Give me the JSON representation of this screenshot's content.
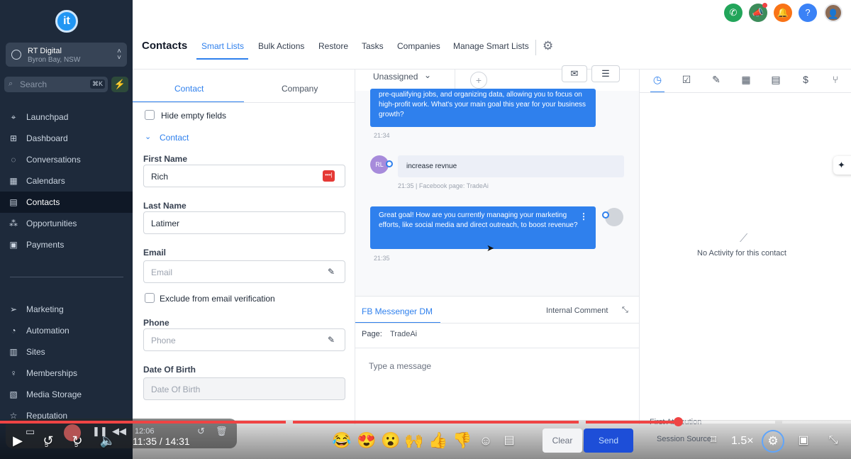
{
  "sidebar": {
    "logo_letter": "it",
    "account_name": "RT Digital",
    "account_location": "Byron Bay, NSW",
    "search_placeholder": "Search",
    "search_shortcut": "⌘K",
    "items_top": [
      {
        "label": "Launchpad",
        "icon": "rocket-icon"
      },
      {
        "label": "Dashboard",
        "icon": "grid-icon"
      },
      {
        "label": "Conversations",
        "icon": "chat-icon"
      },
      {
        "label": "Calendars",
        "icon": "calendar-icon"
      },
      {
        "label": "Contacts",
        "icon": "contact-card-icon",
        "active": true
      },
      {
        "label": "Opportunities",
        "icon": "funnel-icon"
      },
      {
        "label": "Payments",
        "icon": "payment-icon"
      }
    ],
    "items_bottom": [
      {
        "label": "Marketing",
        "icon": "send-icon"
      },
      {
        "label": "Automation",
        "icon": "automation-icon"
      },
      {
        "label": "Sites",
        "icon": "globe-icon"
      },
      {
        "label": "Memberships",
        "icon": "membership-icon"
      },
      {
        "label": "Media Storage",
        "icon": "image-icon"
      },
      {
        "label": "Reputation",
        "icon": "star-icon"
      }
    ]
  },
  "header": {
    "title": "Contacts",
    "tabs": [
      "Smart Lists",
      "Bulk Actions",
      "Restore",
      "Tasks",
      "Companies",
      "Manage Smart Lists"
    ],
    "active_tab": "Smart Lists",
    "help_label": "?"
  },
  "contact_panel": {
    "tabs": [
      "Contact",
      "Company"
    ],
    "hide_empty_label": "Hide empty fields",
    "section_label": "Contact",
    "first_name_label": "First Name",
    "first_name_value": "Rich",
    "last_name_label": "Last Name",
    "last_name_value": "Latimer",
    "email_label": "Email",
    "email_placeholder": "Email",
    "exclude_label": "Exclude from email verification",
    "phone_label": "Phone",
    "phone_placeholder": "Phone",
    "dob_label": "Date Of Birth",
    "dob_placeholder": "Date Of Birth"
  },
  "conversation": {
    "assignee": "Unassigned",
    "messages": [
      {
        "text": "pre-qualifying jobs, and organizing data, allowing you to focus on high-profit work. What's your main goal this year for your business growth?",
        "time": "21:34"
      },
      {
        "initials": "RL",
        "text": "increase revnue",
        "time": "21:35 | Facebook page: TradeAi"
      },
      {
        "text": "Great goal! How are you currently managing your marketing efforts, like social media and direct outreach, to boost revenue?",
        "time": "21:35"
      }
    ],
    "channel_tab": "FB Messenger DM",
    "internal_tab": "Internal Comment",
    "page_label": "Page:",
    "page_value": "TradeAi",
    "message_placeholder": "Type a message",
    "clear_label": "Clear",
    "send_label": "Send"
  },
  "activity": {
    "empty_text": "No Activity for this contact",
    "attribution_label": "First Attribution",
    "session_label": "Session Source"
  },
  "player": {
    "time_current": "11:35",
    "time_total": "14:31",
    "speed": "1.5×",
    "progress": 0.797,
    "rewind_label": "5",
    "forward_label": "5",
    "emojis": [
      "😂",
      "😍",
      "😮",
      "🙌",
      "👍",
      "👎"
    ],
    "overlay_time": "12:06"
  },
  "colors": {
    "sidebar": "#1e2a3b",
    "accent": "#2f80ed",
    "progress": "#ef4444"
  }
}
